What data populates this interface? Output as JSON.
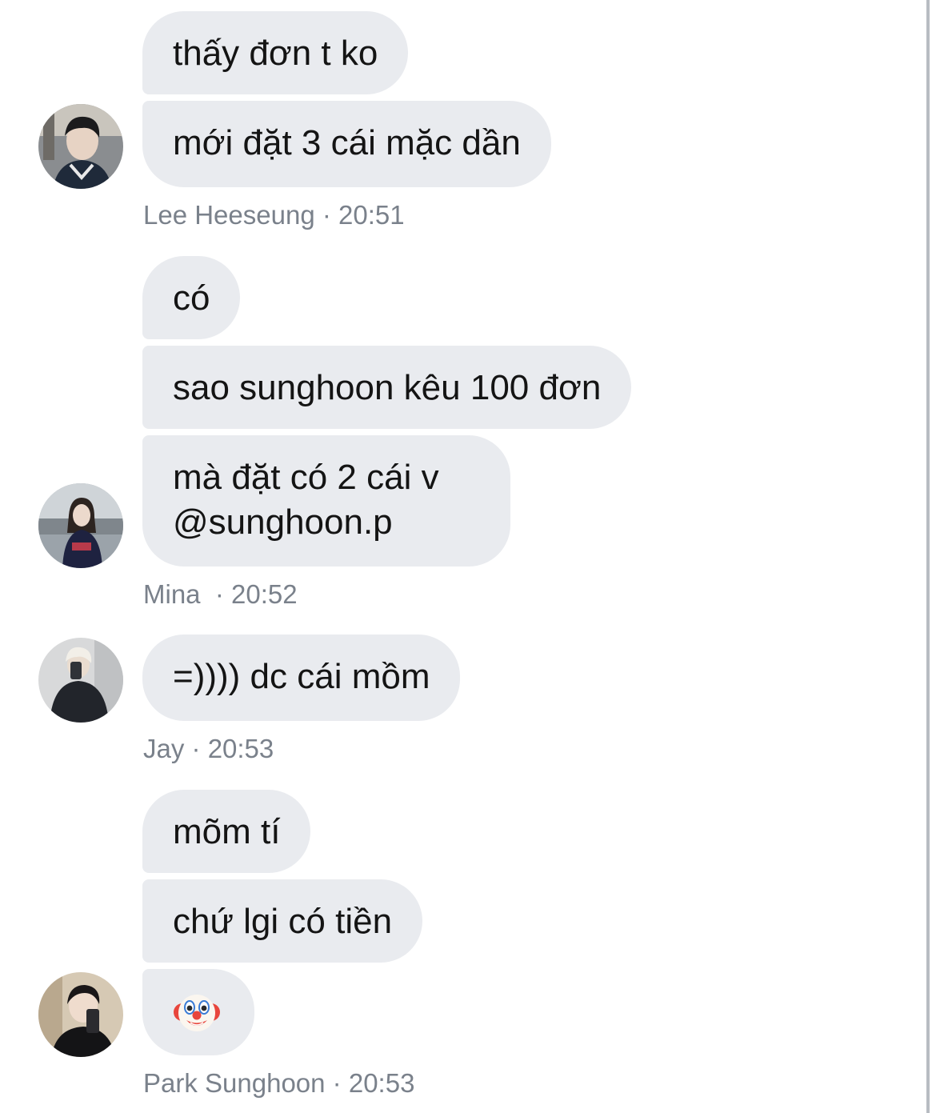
{
  "groups": [
    {
      "sender": "Lee Heeseung",
      "time": "20:51",
      "messages": [
        "thấy đơn t ko",
        "mới đặt 3 cái mặc dần"
      ]
    },
    {
      "sender": "Mina ",
      "time": "20:52",
      "messages": [
        "có",
        "sao sunghoon kêu 100 đơn",
        "mà đặt có 2 cái v @sunghoon.p"
      ]
    },
    {
      "sender": "Jay",
      "time": "20:53",
      "messages": [
        "=)))) dc cái mồm"
      ]
    },
    {
      "sender": "Park Sunghoon",
      "time": "20:53",
      "messages": [
        "mõm tí",
        "chứ lgi có tiền",
        "🤡"
      ]
    }
  ],
  "colors": {
    "bubble_bg": "#e9ebef",
    "text": "#141414",
    "meta_text": "#7a818b",
    "scrollbar": "#b8bcc2"
  },
  "icons": {
    "emoji_last": "clown-face-icon"
  }
}
